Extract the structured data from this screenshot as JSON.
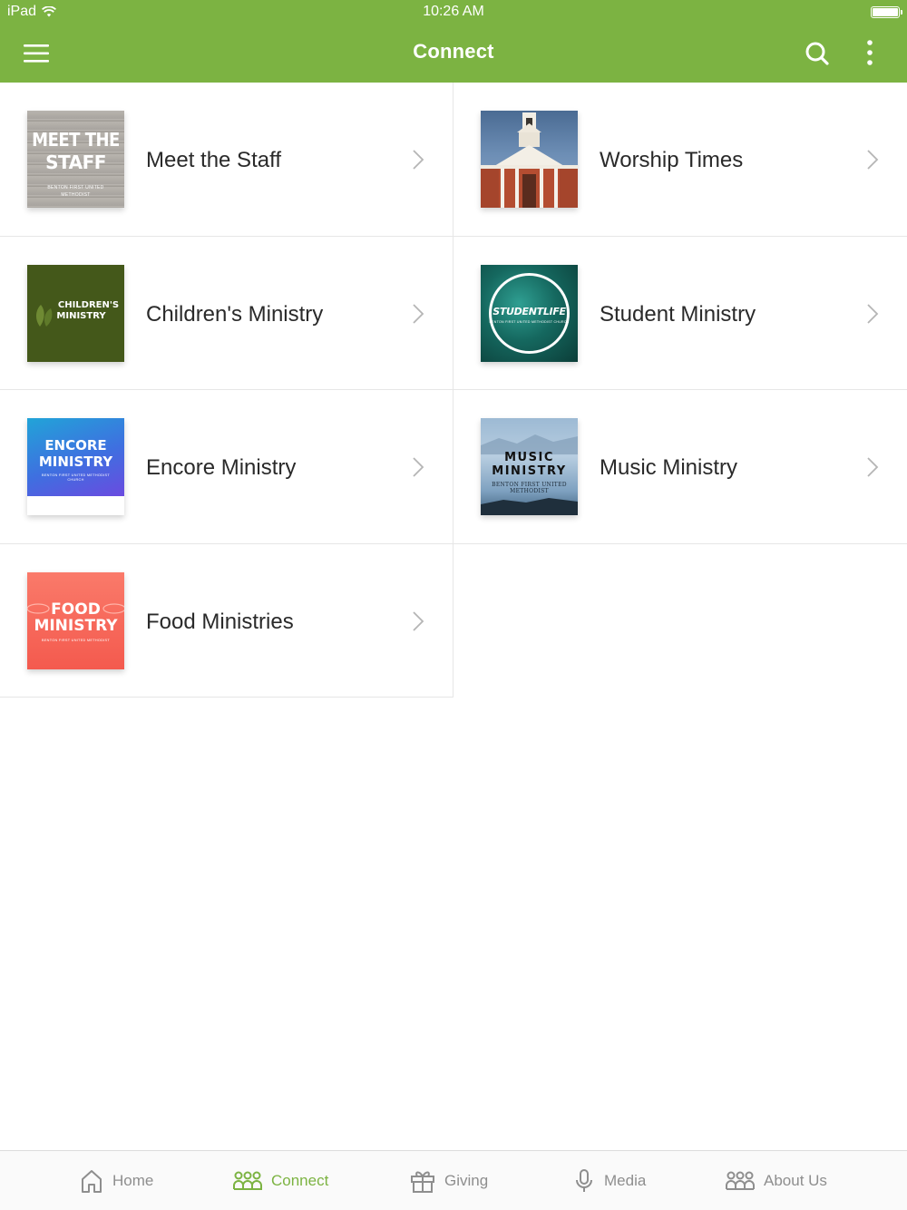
{
  "status_bar": {
    "device": "iPad",
    "time": "10:26 AM"
  },
  "app_bar": {
    "title": "Connect"
  },
  "tiles": [
    {
      "label": "Meet the Staff",
      "thumb": {
        "line1": "MEET THE",
        "line2": "STAFF",
        "sub1": "BENTON FIRST UNITED",
        "sub2": "METHODIST"
      }
    },
    {
      "label": "Worship Times"
    },
    {
      "label": "Children's Ministry",
      "thumb": {
        "line1": "CHILDREN'S",
        "line2": "MINISTRY"
      }
    },
    {
      "label": "Student Ministry",
      "thumb": {
        "line1": "STUDENTLIFE",
        "sub1": "BENTON FIRST UNITED METHODIST CHURCH"
      }
    },
    {
      "label": "Encore Ministry",
      "thumb": {
        "line1": "ENCORE",
        "line2": "MINISTRY",
        "sub1": "BENTON FIRST UNITED METHODIST",
        "sub2": "CHURCH"
      }
    },
    {
      "label": "Music Ministry",
      "thumb": {
        "line1": "MUSIC",
        "line2": "MINISTRY",
        "sub1": "BENTON FIRST UNITED",
        "sub2": "METHODIST"
      }
    },
    {
      "label": "Food Ministries",
      "thumb": {
        "line1": "FOOD",
        "line2": "MINISTRY",
        "sub1": "BENTON FIRST UNITED METHODIST"
      }
    }
  ],
  "tab_bar": [
    {
      "label": "Home",
      "icon": "home-icon",
      "active": false
    },
    {
      "label": "Connect",
      "icon": "people-icon",
      "active": true
    },
    {
      "label": "Giving",
      "icon": "gift-icon",
      "active": false
    },
    {
      "label": "Media",
      "icon": "microphone-icon",
      "active": false
    },
    {
      "label": "About Us",
      "icon": "people-icon",
      "active": false
    }
  ],
  "colors": {
    "primary": "#7cb342",
    "tab_inactive": "#8e8e8e",
    "divider": "#e6e6e6"
  }
}
